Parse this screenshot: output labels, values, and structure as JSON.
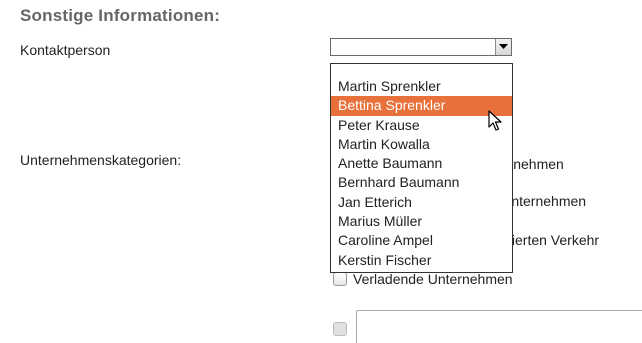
{
  "section_title": "Sonstige Informationen:",
  "contact": {
    "label": "Kontaktperson",
    "selected_value": "",
    "options": [
      "Martin Sprenkler",
      "Bettina Sprenkler",
      "Peter Krause",
      "Martin Kowalla",
      "Anette Baumann",
      "Bernhard Baumann",
      "Jan Etterich",
      "Marius Müller",
      "Caroline Ampel",
      "Kerstin Fischer"
    ],
    "highlighted_index": 1,
    "highlight_color": "#e8703a"
  },
  "categories": {
    "label": "Unternehmenskategorien:",
    "visible_fragments": [
      "Unternehmen",
      "rtunternehmen",
      "inierten Verkehr",
      "Verladende Unternehmen"
    ]
  },
  "cursor_icon": "arrow-pointer"
}
